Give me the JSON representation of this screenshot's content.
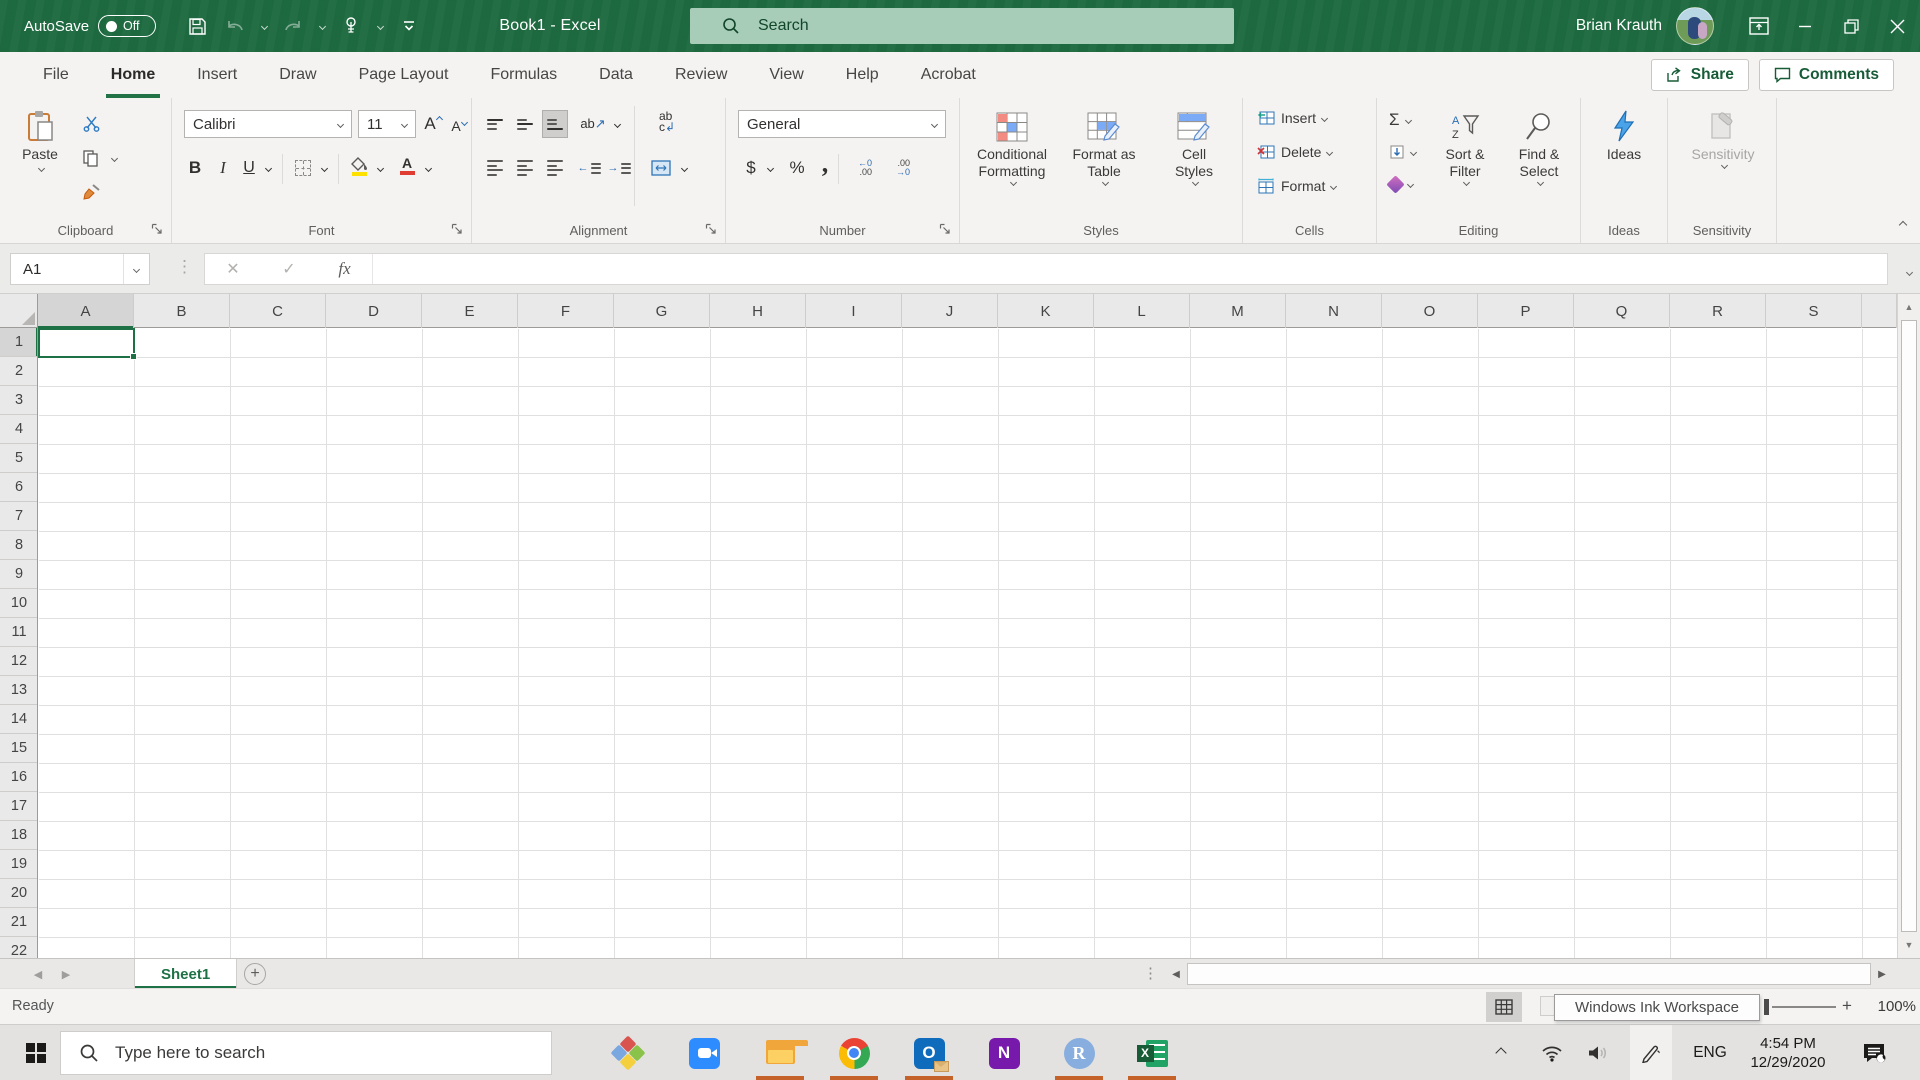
{
  "app": {
    "title": "Book1 - Excel",
    "user": "Brian Krauth"
  },
  "titlebar": {
    "autosave_label": "AutoSave",
    "autosave_state": "Off",
    "search_placeholder": "Search",
    "quick_access_icons": [
      "save",
      "undo",
      "redo",
      "touch-mouse-mode",
      "customize-quick-access-toolbar"
    ],
    "window_control_icons": [
      "ribbon-display-options",
      "minimize",
      "restore",
      "close"
    ]
  },
  "ribbon_tabs": [
    {
      "label": "File",
      "active": false
    },
    {
      "label": "Home",
      "active": true
    },
    {
      "label": "Insert",
      "active": false
    },
    {
      "label": "Draw",
      "active": false
    },
    {
      "label": "Page Layout",
      "active": false
    },
    {
      "label": "Formulas",
      "active": false
    },
    {
      "label": "Data",
      "active": false
    },
    {
      "label": "Review",
      "active": false
    },
    {
      "label": "View",
      "active": false
    },
    {
      "label": "Help",
      "active": false
    },
    {
      "label": "Acrobat",
      "active": false
    }
  ],
  "actions": {
    "share": "Share",
    "comments": "Comments"
  },
  "ribbon": {
    "clipboard": {
      "label": "Clipboard",
      "paste": "Paste",
      "icons": [
        "paste",
        "cut",
        "copy",
        "format-painter"
      ]
    },
    "font": {
      "label": "Font",
      "font_name": "Calibri",
      "font_size": "11",
      "bold": "B",
      "italic": "I",
      "underline": "U"
    },
    "alignment": {
      "label": "Alignment",
      "orientation": "ab",
      "wrap": "ab"
    },
    "number": {
      "label": "Number",
      "format": "General",
      "currency": "$",
      "percent": "%",
      "comma": ",",
      "increase_decimal": [
        "←0",
        ".00"
      ],
      "decrease_decimal": [
        ".00",
        "→0"
      ]
    },
    "styles": {
      "label": "Styles",
      "conditional_formatting": "Conditional Formatting",
      "format_as_table": "Format as Table",
      "cell_styles": "Cell Styles"
    },
    "cells": {
      "label": "Cells",
      "insert": "Insert",
      "delete": "Delete",
      "format": "Format"
    },
    "editing": {
      "label": "Editing",
      "autosum": "Σ",
      "sort_letters": [
        "A",
        "Z"
      ],
      "sort_filter": "Sort & Filter",
      "find_select": "Find & Select"
    },
    "ideas": {
      "label": "Ideas",
      "button": "Ideas"
    },
    "sensitivity": {
      "label": "Sensitivity",
      "button": "Sensitivity",
      "disabled": true
    }
  },
  "formula_bar": {
    "name_box": "A1",
    "insert_function": "fx",
    "value": ""
  },
  "grid": {
    "columns": [
      "A",
      "B",
      "C",
      "D",
      "E",
      "F",
      "G",
      "H",
      "I",
      "J",
      "K",
      "L",
      "M",
      "N",
      "O",
      "P",
      "Q",
      "R",
      "S"
    ],
    "rows": [
      "1",
      "2",
      "3",
      "4",
      "5",
      "6",
      "7",
      "8",
      "9",
      "10",
      "11",
      "12",
      "13",
      "14",
      "15",
      "16",
      "17",
      "18",
      "19",
      "20",
      "21",
      "22"
    ],
    "selected_cell": "A1"
  },
  "sheet_bar": {
    "tabs": [
      {
        "label": "Sheet1",
        "active": true
      }
    ],
    "add_sheet": "+"
  },
  "status_bar": {
    "mode": "Ready",
    "view_icons": [
      "normal-view",
      "page-layout-view",
      "page-break-preview"
    ],
    "tooltip": "Windows Ink Workspace",
    "zoom_in": "+",
    "zoom_level": "100%"
  },
  "taskbar": {
    "search_placeholder": "Type here to search",
    "app_icons": [
      {
        "name": "rootsmagic",
        "running": false
      },
      {
        "name": "zoom",
        "running": false
      },
      {
        "name": "file-explorer",
        "running": true
      },
      {
        "name": "chrome",
        "running": true
      },
      {
        "name": "outlook",
        "running": true
      },
      {
        "name": "onenote",
        "running": false
      },
      {
        "name": "rstudio",
        "running": true
      },
      {
        "name": "excel",
        "running": true
      }
    ],
    "tray": {
      "language": "ENG",
      "time": "4:54 PM",
      "date": "12/29/2020",
      "icons": [
        "hidden-icons-chevron",
        "wifi",
        "volume",
        "pen",
        "action-center"
      ]
    }
  },
  "colors": {
    "excel_green": "#1e6b40",
    "selection_green": "#1e7145",
    "running_indicator": "#c4622a",
    "search_box_green": "#a7ccb8"
  }
}
